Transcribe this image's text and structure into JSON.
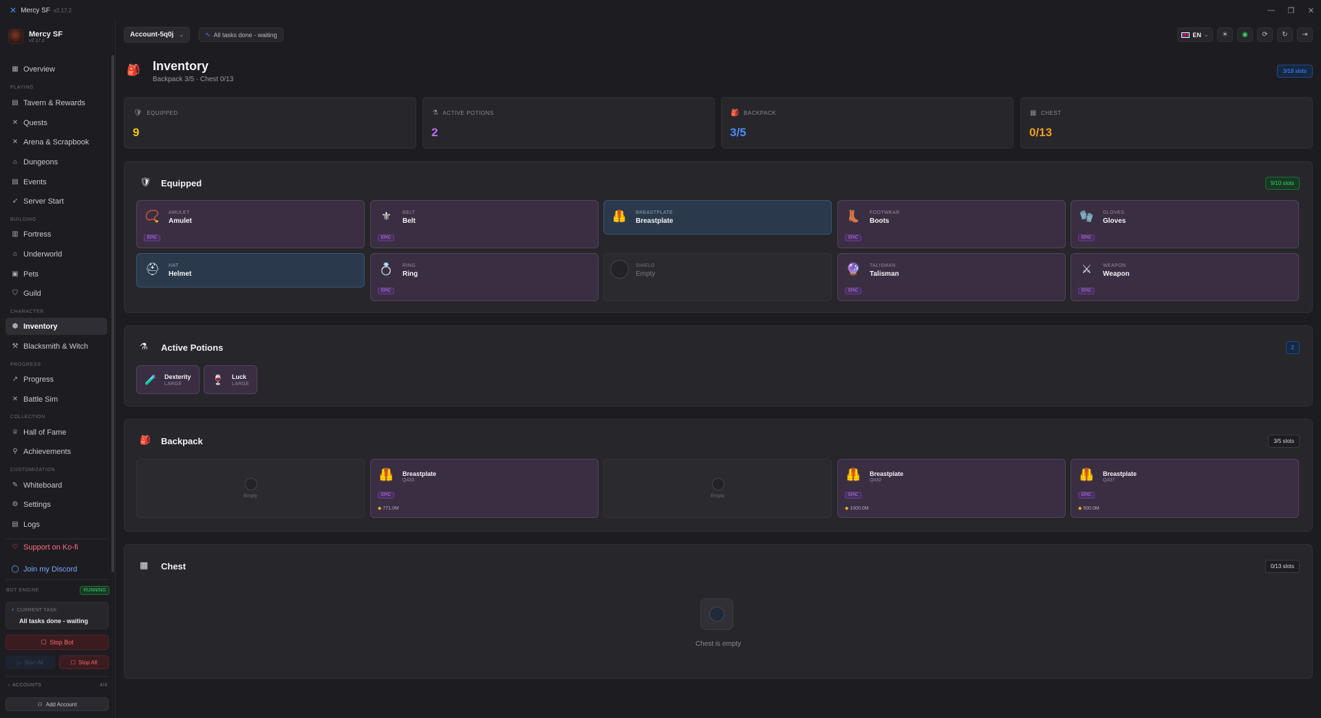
{
  "app": {
    "title": "Mercy SF",
    "version": "v2.17.2"
  },
  "profile": {
    "name": "Mercy SF",
    "version": "v2.17.2"
  },
  "nav": {
    "overview": "Overview",
    "sec_playing": "PLAYING",
    "tavern": "Tavern & Rewards",
    "quests": "Quests",
    "arena": "Arena & Scrapbook",
    "dungeons": "Dungeons",
    "events": "Events",
    "server_start": "Server Start",
    "sec_building": "BUILDING",
    "fortress": "Fortress",
    "underworld": "Underworld",
    "pets": "Pets",
    "guild": "Guild",
    "sec_character": "CHARACTER",
    "inventory": "Inventory",
    "blacksmith": "Blacksmith & Witch",
    "sec_progress": "PROGRESS",
    "progress": "Progress",
    "battle_sim": "Battle Sim",
    "sec_collection": "COLLECTION",
    "hall_of_fame": "Hall of Fame",
    "achievements": "Achievements",
    "sec_customization": "CUSTOMIZATION",
    "whiteboard": "Whiteboard",
    "settings": "Settings",
    "logs": "Logs",
    "kofi": "Support on Ko-fi",
    "discord": "Join my Discord"
  },
  "bot": {
    "engine_label": "BOT ENGINE",
    "status": "RUNNING",
    "current_task_label": "CURRENT TASK",
    "current_task": "All tasks done - waiting",
    "stop_bot": "Stop Bot",
    "start_all": "Start All",
    "stop_all": "Stop All",
    "accounts_label": "ACCOUNTS",
    "accounts_count": "4/4",
    "add_account": "Add Account"
  },
  "topbar": {
    "account": "Account-5q0j",
    "status": "All tasks done - waiting",
    "lang": "EN"
  },
  "page": {
    "title": "Inventory",
    "subtitle": "Backpack 3/5 · Chest 0/13",
    "slots_badge": "3/18 slots"
  },
  "stats": [
    {
      "label": "EQUIPPED",
      "value": "9",
      "color": "#f5c518"
    },
    {
      "label": "ACTIVE POTIONS",
      "value": "2",
      "color": "#c46cf0"
    },
    {
      "label": "BACKPACK",
      "value": "3/5",
      "color": "#4b8df8"
    },
    {
      "label": "CHEST",
      "value": "0/13",
      "color": "#f0a020"
    }
  ],
  "equipped": {
    "title": "Equipped",
    "badge": "9/10 slots",
    "epic_label": "EPIC",
    "items": [
      {
        "kind": "AMULET",
        "name": "Amulet"
      },
      {
        "kind": "BELT",
        "name": "Belt"
      },
      {
        "kind": "BREASTPLATE",
        "name": "Breastplate"
      },
      {
        "kind": "FOOTWEAR",
        "name": "Boots"
      },
      {
        "kind": "GLOVES",
        "name": "Gloves"
      },
      {
        "kind": "HAT",
        "name": "Helmet"
      },
      {
        "kind": "RING",
        "name": "Ring"
      },
      {
        "kind": "SHIELD",
        "name": "Empty"
      },
      {
        "kind": "TALISMAN",
        "name": "Talisman"
      },
      {
        "kind": "WEAPON",
        "name": "Weapon"
      }
    ]
  },
  "potions": {
    "title": "Active Potions",
    "badge": "2",
    "items": [
      {
        "name": "Dexterity",
        "size": "LARGE"
      },
      {
        "name": "Luck",
        "size": "LARGE"
      }
    ]
  },
  "backpack": {
    "title": "Backpack",
    "badge": "3/5 slots",
    "empty_label": "Empty",
    "epic_label": "EPIC",
    "items": [
      {
        "name": "Breastplate",
        "quality": "Q433",
        "gold": "771.0M"
      },
      {
        "name": "Breastplate",
        "quality": "Q432",
        "gold": "1000.0M"
      },
      {
        "name": "Breastplate",
        "quality": "Q437",
        "gold": "500.0M"
      }
    ]
  },
  "chest": {
    "title": "Chest",
    "badge": "0/13 slots",
    "empty_message": "Chest is empty"
  }
}
